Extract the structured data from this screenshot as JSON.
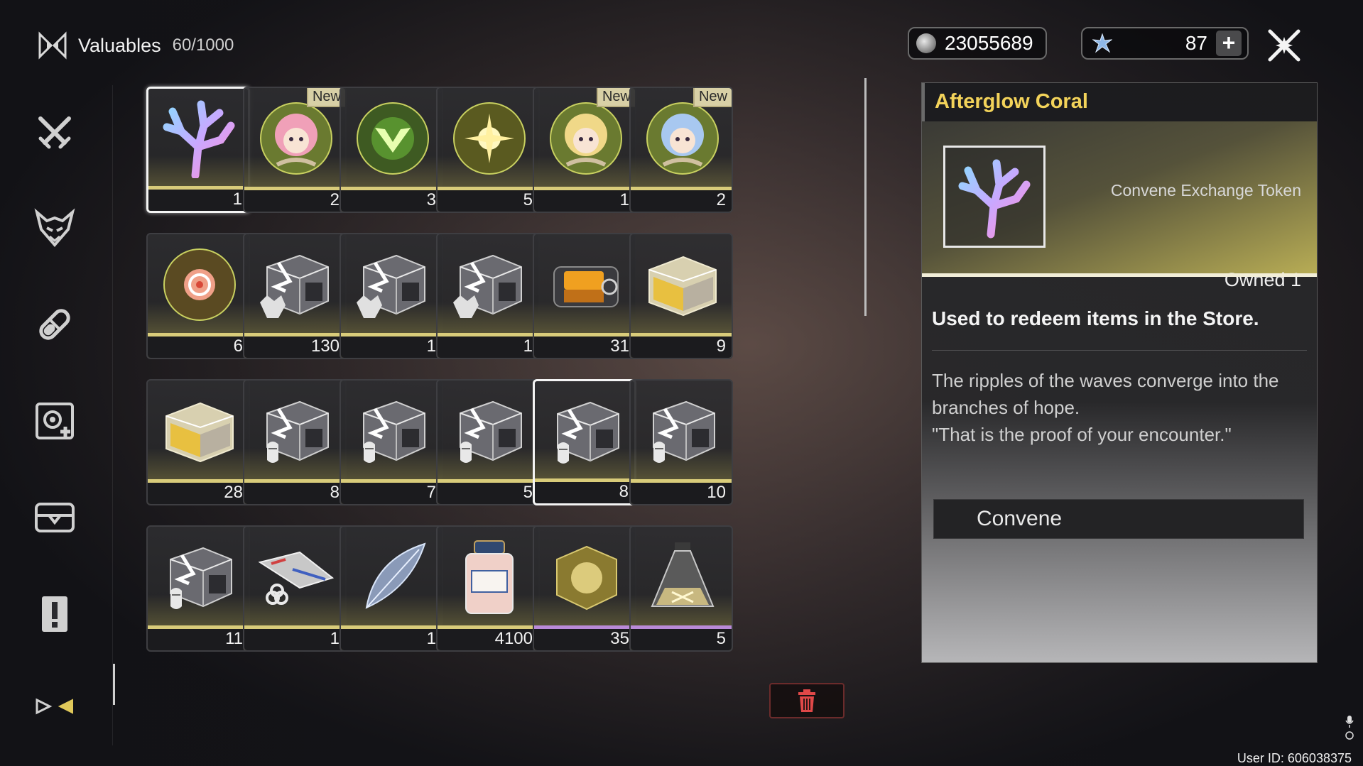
{
  "header": {
    "title": "Valuables",
    "capacity": "60/1000"
  },
  "currencies": {
    "shell_credits": "23055689",
    "astrite": "87",
    "plus_label": "+"
  },
  "sidebar": {
    "items": [
      {
        "name": "weapon"
      },
      {
        "name": "echo"
      },
      {
        "name": "upgrade-material"
      },
      {
        "name": "development"
      },
      {
        "name": "resources"
      },
      {
        "name": "quest-items"
      },
      {
        "name": "special"
      }
    ]
  },
  "grid": {
    "items": [
      {
        "icon": "coral",
        "count": "1",
        "badge": "",
        "selected": true
      },
      {
        "icon": "portrait-pink",
        "count": "2",
        "badge": "New"
      },
      {
        "icon": "orb-green",
        "count": "3",
        "badge": ""
      },
      {
        "icon": "orb-star",
        "count": "5",
        "badge": ""
      },
      {
        "icon": "portrait-yellow",
        "count": "1",
        "badge": "New"
      },
      {
        "icon": "portrait-blue",
        "count": "2",
        "badge": "New"
      },
      {
        "icon": "orb-red",
        "count": "6",
        "badge": ""
      },
      {
        "icon": "chest-wolf",
        "count": "130",
        "badge": ""
      },
      {
        "icon": "chest-wolf",
        "count": "1",
        "badge": ""
      },
      {
        "icon": "chest-wolf",
        "count": "1",
        "badge": ""
      },
      {
        "icon": "chest-orange",
        "count": "31",
        "badge": ""
      },
      {
        "icon": "crate-gold",
        "count": "9",
        "badge": ""
      },
      {
        "icon": "crate-gold",
        "count": "28",
        "badge": ""
      },
      {
        "icon": "chest-mask",
        "count": "8",
        "badge": ""
      },
      {
        "icon": "chest-mask",
        "count": "7",
        "badge": ""
      },
      {
        "icon": "chest-mask",
        "count": "5",
        "badge": ""
      },
      {
        "icon": "chest-mask",
        "count": "8",
        "badge": "",
        "hover": true
      },
      {
        "icon": "chest-mask",
        "count": "10",
        "badge": ""
      },
      {
        "icon": "chest-mask",
        "count": "11",
        "badge": ""
      },
      {
        "icon": "glider",
        "count": "1",
        "badge": ""
      },
      {
        "icon": "feather",
        "count": "1",
        "badge": ""
      },
      {
        "icon": "jar",
        "count": "4100",
        "badge": ""
      },
      {
        "icon": "cube",
        "count": "35",
        "badge": "",
        "purple": true
      },
      {
        "icon": "flask",
        "count": "5",
        "badge": "",
        "purple": true
      }
    ]
  },
  "detail": {
    "name": "Afterglow Coral",
    "type": "Convene Exchange Token",
    "owned": "Owned 1",
    "usage": "Used to redeem items in the Store.",
    "lore": [
      "The ripples of the waves converge into the",
      "branches of hope.",
      "\"That is the proof of your encounter.\""
    ],
    "action_label": "Convene"
  },
  "footer": {
    "user_id": "User ID: 606038375"
  },
  "colors": {
    "accent_gold": "#f3d35a",
    "rarity_bar": "#d9cc7a",
    "rarity_purple": "#b98ad8",
    "delete_red": "#e04848"
  }
}
